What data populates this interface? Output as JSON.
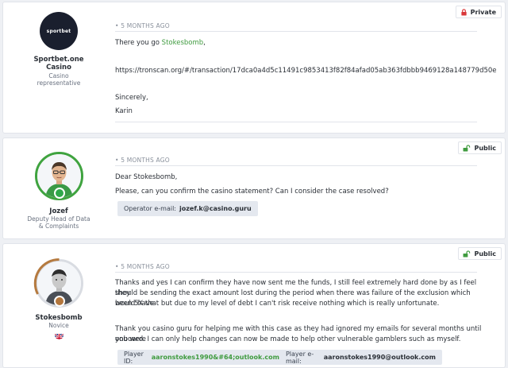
{
  "posts": [
    {
      "author": {
        "name_line1": "Sportbet.one",
        "name_line2": "Casino",
        "role_line1": "Casino",
        "role_line2": "representative",
        "logo_text": "sportbet"
      },
      "date": "• 5 MONTHS AGO",
      "visibility": "Private",
      "body": {
        "greeting_prefix": "There you go ",
        "greeting_user": "Stokesbomb",
        "greeting_suffix": ",",
        "link": "https://tronscan.org/#/transaction/17dca0a4d5c11491c9853413f82f84afad05ab363fdbbb9469128a148779d50e",
        "signoff": "Sincerely,",
        "signature": "Karin"
      }
    },
    {
      "author": {
        "name": "Jozef",
        "role_line1": "Deputy Head of Data",
        "role_line2": "& Complaints"
      },
      "date": "• 5 MONTHS AGO",
      "visibility": "Public",
      "body": {
        "greeting": "Dear Stokesbomb,",
        "question": "Please, can you confirm the casino statement? Can I consider the case resolved?"
      },
      "chip": {
        "label": "Operator e-mail: ",
        "value": "jozef.k@casino.guru"
      }
    },
    {
      "author": {
        "name": "Stokesbomb",
        "role": "Novice",
        "flag": "uk-flag"
      },
      "date": "• 5 MONTHS AGO",
      "visibility": "Public",
      "body": {
        "para1_l1": "Thanks and yes I can confirm they have now sent me the funds, I still feel extremely hard done by as I feel they",
        "para1_l2": "should be sending the exact amount lost during the period when there was failure of the exclusion which would have",
        "para1_l3": "been 5X that but due to my level of debt I can't risk receive nothing which is really unfortunate.",
        "para2_l1": "Thank you casino guru for helping me with this case as they had ignored my emails for several months until you were",
        "para2_l2": "onboard. I can only help changes can now be made to help other vulnerable gamblers such as myself."
      },
      "chip": {
        "player_id_label": "Player ID: ",
        "player_id": "aaronstokes1990&#64;outlook.com",
        "email_label": "Player e-mail: ",
        "email": "aaronstokes1990@outlook.com"
      }
    }
  ]
}
